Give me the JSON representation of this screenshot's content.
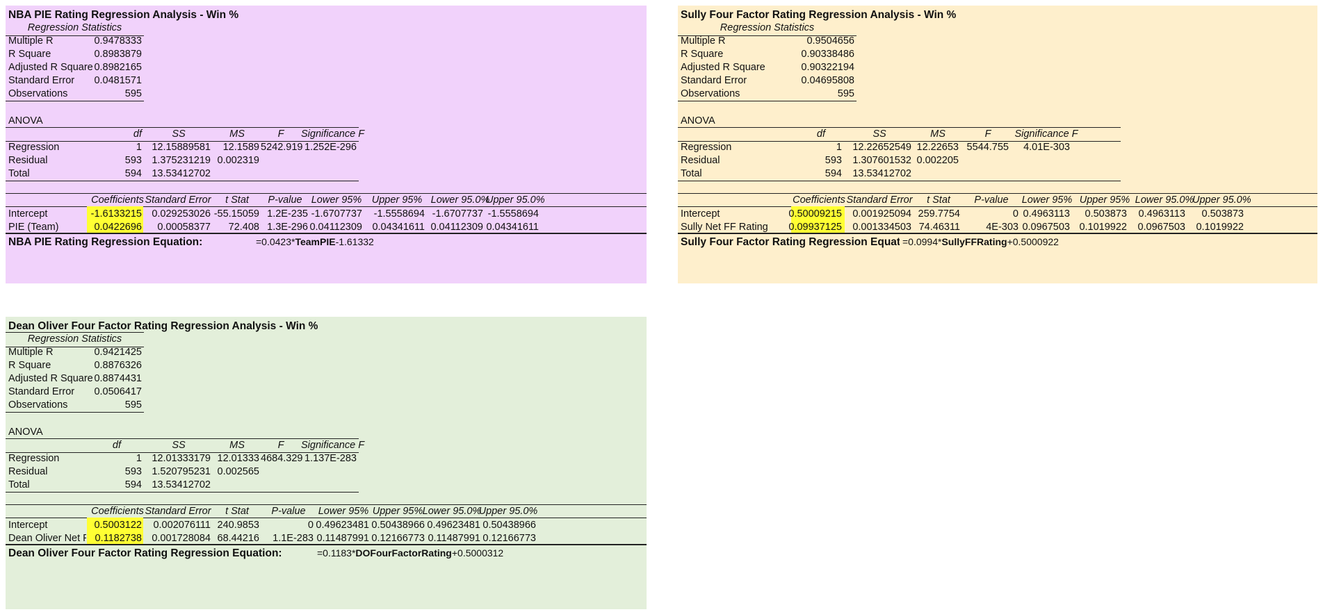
{
  "panels": [
    {
      "id": "pie",
      "title": "NBA PIE Rating Regression Analysis - Win %",
      "regression_statistics_header": "Regression Statistics",
      "regression_statistics": [
        {
          "label": "Multiple R",
          "value": "0.9478333"
        },
        {
          "label": "R Square",
          "value": "0.8983879"
        },
        {
          "label": "Adjusted R Square",
          "value": "0.8982165"
        },
        {
          "label": "Standard Error",
          "value": "0.0481571"
        },
        {
          "label": "Observations",
          "value": "595"
        }
      ],
      "anova_label": "ANOVA",
      "anova_headers": [
        "df",
        "SS",
        "MS",
        "F",
        "Significance F"
      ],
      "anova_rows": [
        {
          "label": "Regression",
          "df": "1",
          "ss": "12.15889581",
          "ms": "12.1589",
          "f": "5242.919",
          "sig": "1.252E-296"
        },
        {
          "label": "Residual",
          "df": "593",
          "ss": "1.375231219",
          "ms": "0.002319",
          "f": "",
          "sig": ""
        },
        {
          "label": "Total",
          "df": "594",
          "ss": "13.53412702",
          "ms": "",
          "f": "",
          "sig": ""
        }
      ],
      "coef_headers": [
        "Coefficients",
        "Standard Error",
        "t Stat",
        "P-value",
        "Lower 95%",
        "Upper 95%",
        "Lower 95.0%",
        "Upper 95.0%"
      ],
      "coef_rows": [
        {
          "label": "Intercept",
          "values": [
            "-1.6133215",
            "0.029253026",
            "-55.15059",
            "1.2E-235",
            "-1.6707737",
            "-1.5558694",
            "-1.6707737",
            "-1.5558694"
          ]
        },
        {
          "label": "PIE (Team)",
          "values": [
            "0.0422696",
            "0.00058377",
            "72.408",
            "1.3E-296",
            "0.04112309",
            "0.04341611",
            "0.04112309",
            "0.04341611"
          ]
        }
      ],
      "equation_label": "NBA PIE Rating Regression Equation:",
      "equation": {
        "prefix": "=0.0423*",
        "var": "TeamPIE",
        "suffix": "-1.61332"
      }
    },
    {
      "id": "sully",
      "title": "Sully  Four Factor Rating Regression Analysis - Win %",
      "regression_statistics_header": "Regression Statistics",
      "regression_statistics": [
        {
          "label": "Multiple R",
          "value": "0.9504656"
        },
        {
          "label": "R Square",
          "value": "0.90338486"
        },
        {
          "label": "Adjusted R Square",
          "value": "0.90322194"
        },
        {
          "label": "Standard Error",
          "value": "0.04695808"
        },
        {
          "label": "Observations",
          "value": "595"
        }
      ],
      "anova_label": "ANOVA",
      "anova_headers": [
        "df",
        "SS",
        "MS",
        "F",
        "Significance F"
      ],
      "anova_rows": [
        {
          "label": "Regression",
          "df": "1",
          "ss": "12.22652549",
          "ms": "12.22653",
          "f": "5544.755",
          "sig": "4.01E-303"
        },
        {
          "label": "Residual",
          "df": "593",
          "ss": "1.307601532",
          "ms": "0.002205",
          "f": "",
          "sig": ""
        },
        {
          "label": "Total",
          "df": "594",
          "ss": "13.53412702",
          "ms": "",
          "f": "",
          "sig": ""
        }
      ],
      "coef_headers": [
        "Coefficients",
        "Standard Error",
        "t Stat",
        "P-value",
        "Lower 95%",
        "Upper 95%",
        "Lower 95.0%",
        "Upper 95.0%"
      ],
      "coef_rows": [
        {
          "label": "Intercept",
          "values": [
            "0.50009215",
            "0.001925094",
            "259.7754",
            "0",
            "0.4963113",
            "0.503873",
            "0.4963113",
            "0.503873"
          ]
        },
        {
          "label": "Sully Net FF Rating",
          "values": [
            "0.09937125",
            "0.001334503",
            "74.46311",
            "4E-303",
            "0.0967503",
            "0.1019922",
            "0.0967503",
            "0.1019922"
          ]
        }
      ],
      "equation_label": "Sully  Four Factor Rating Regression Equation:",
      "equation": {
        "prefix": "=0.0994*",
        "var": "SullyFFRating",
        "suffix": "+0.5000922"
      }
    },
    {
      "id": "oliver",
      "title": "Dean Oliver Four Factor Rating Regression Analysis - Win %",
      "regression_statistics_header": "Regression Statistics",
      "regression_statistics": [
        {
          "label": "Multiple R",
          "value": "0.9421425"
        },
        {
          "label": "R Square",
          "value": "0.8876326"
        },
        {
          "label": "Adjusted R Square",
          "value": "0.8874431"
        },
        {
          "label": "Standard Error",
          "value": "0.0506417"
        },
        {
          "label": "Observations",
          "value": "595"
        }
      ],
      "anova_label": "ANOVA",
      "anova_headers": [
        "df",
        "SS",
        "MS",
        "F",
        "Significance F"
      ],
      "anova_rows": [
        {
          "label": "Regression",
          "df": "1",
          "ss": "12.01333179",
          "ms": "12.01333",
          "f": "4684.329",
          "sig": "1.137E-283"
        },
        {
          "label": "Residual",
          "df": "593",
          "ss": "1.520795231",
          "ms": "0.002565",
          "f": "",
          "sig": ""
        },
        {
          "label": "Total",
          "df": "594",
          "ss": "13.53412702",
          "ms": "",
          "f": "",
          "sig": ""
        }
      ],
      "coef_headers": [
        "Coefficients",
        "Standard Error",
        "t Stat",
        "P-value",
        "Lower 95%",
        "Upper 95%",
        "Lower 95.0%",
        "Upper 95.0%"
      ],
      "coef_rows": [
        {
          "label": "Intercept",
          "values": [
            "0.5003122",
            "0.002076111",
            "240.9853",
            "0",
            "0.49623481",
            "0.50438966",
            "0.49623481",
            "0.50438966"
          ]
        },
        {
          "label": "Dean Oliver Net FF",
          "values": [
            "0.1182738",
            "0.001728084",
            "68.44216",
            "1.1E-283",
            "0.11487991",
            "0.12166773",
            "0.11487991",
            "0.12166773"
          ]
        }
      ],
      "equation_label": "Dean Oliver Four Factor Rating Regression Equation:",
      "equation": {
        "prefix": "=0.1183*",
        "var": "DOFourFactorRating",
        "suffix": "+0.5000312"
      }
    }
  ],
  "colors": {
    "pie_background": "#f1d2fb",
    "sully_background": "#feefcc",
    "oliver_background": "#e3efda",
    "highlight": "#ffff33"
  }
}
